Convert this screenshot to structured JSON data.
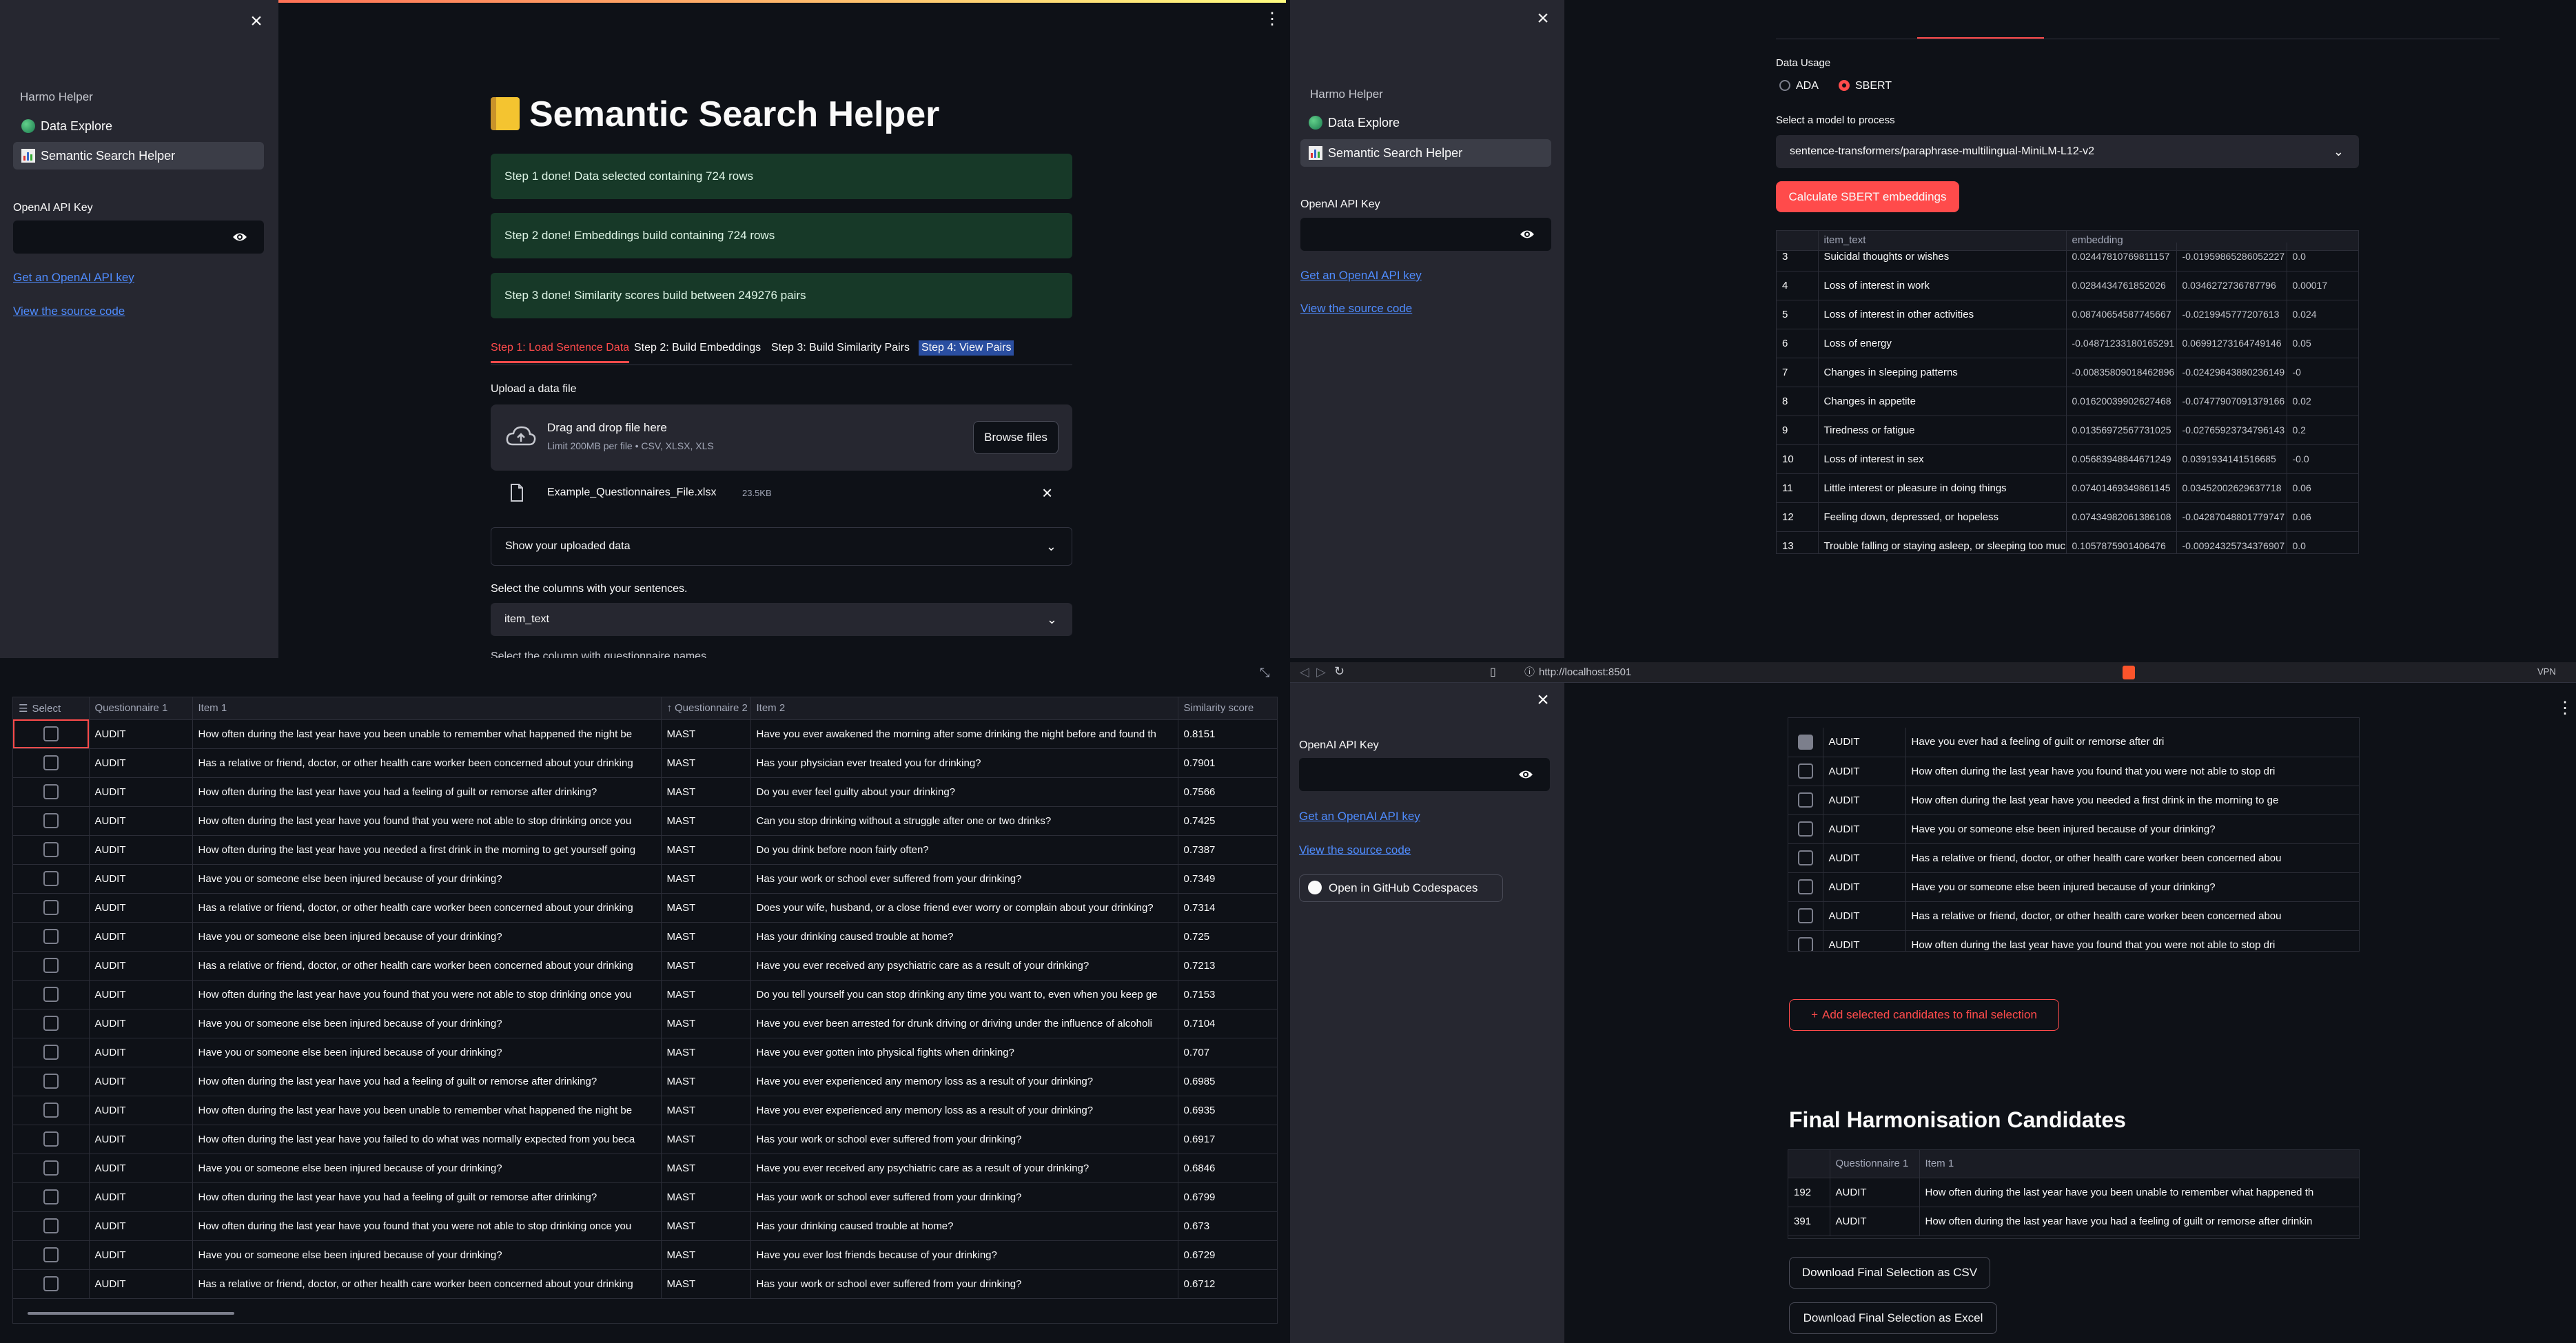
{
  "q1": {
    "sidebar": {
      "app_name": "Harmo Helper",
      "nav": [
        {
          "label": "Data Explore",
          "icon": "globe-icon"
        },
        {
          "label": "Semantic Search Helper",
          "icon": "bar-chart-icon"
        }
      ],
      "api_label": "OpenAI API Key",
      "link_key": "Get an OpenAI API key",
      "link_source": "View the source code"
    },
    "title": "Semantic Search Helper",
    "title_icon": "ledger-icon",
    "success": [
      "Step 1 done! Data selected containing 724 rows",
      "Step 2 done! Embeddings build containing 724 rows",
      "Step 3 done! Similarity scores build between 249276 pairs"
    ],
    "tabs": [
      "Step 1: Load Sentence Data",
      "Step 2: Build Embeddings",
      "Step 3: Build Similarity Pairs",
      "Step 4: View Pairs"
    ],
    "upload_label": "Upload a data file",
    "drop_text": "Drag and drop file here",
    "drop_limit": "Limit 200MB per file • CSV, XLSX, XLS",
    "browse": "Browse files",
    "file_name": "Example_Questionnaires_File.xlsx",
    "file_size": "23.5KB",
    "expander": "Show your uploaded data",
    "col_label": "Select the columns with your sentences.",
    "col_value": "item_text",
    "cut_text": "Select the column with questionnaire names"
  },
  "q2": {
    "sidebar": {
      "app_name": "Harmo Helper",
      "nav": [
        {
          "label": "Data Explore"
        },
        {
          "label": "Semantic Search Helper"
        }
      ],
      "api_label": "OpenAI API Key",
      "link_key": "Get an OpenAI API key",
      "link_source": "View the source code"
    },
    "usage_label": "Data Usage",
    "radio": [
      "ADA",
      "SBERT"
    ],
    "model_label": "Select a model to process",
    "model_value": "sentence-transformers/paraphrase-multilingual-MiniLM-L12-v2",
    "calc_button": "Calculate SBERT embeddings",
    "headers": [
      "",
      "item_text",
      "embedding"
    ],
    "rows": [
      [
        "3",
        "Suicidal thoughts or wishes",
        "0.02447810769811157",
        "-0.01959865286052227",
        "0.0"
      ],
      [
        "4",
        "Loss of interest in work",
        "0.0284434761852026",
        "0.0346272736787796",
        "0.00017"
      ],
      [
        "5",
        "Loss of interest in other activities",
        "0.08740654587745667",
        "-0.0219945777207613",
        "0.024"
      ],
      [
        "6",
        "Loss of energy",
        "-0.04871233180165291",
        "0.06991273164749146",
        "0.05"
      ],
      [
        "7",
        "Changes in sleeping patterns",
        "-0.00835809018462896",
        "-0.02429843880236149",
        "-0"
      ],
      [
        "8",
        "Changes in appetite",
        "0.01620039902627468",
        "-0.07477907091379166",
        "0.02"
      ],
      [
        "9",
        "Tiredness or fatigue",
        "0.01356972567731025",
        "-0.02765923734796143",
        "0.2"
      ],
      [
        "10",
        "Loss of interest in sex",
        "0.05683948844671249",
        "0.0391934141516685",
        "-0.0"
      ],
      [
        "11",
        "Little interest or pleasure in doing things",
        "0.07401469349861145",
        "0.03452002629637718",
        "0.06"
      ],
      [
        "12",
        "Feeling down, depressed, or hopeless",
        "0.07434982061386108",
        "-0.04287048801779747",
        "0.06"
      ],
      [
        "13",
        "Trouble falling or staying asleep, or sleeping too much",
        "0.1057875901406476",
        "-0.00924325734376907",
        "0.0"
      ]
    ]
  },
  "q3": {
    "headers": [
      "Select",
      "Questionnaire 1",
      "Item 1",
      "Questionnaire 2",
      "Item 2",
      "Similarity score"
    ],
    "rows": [
      [
        "AUDIT",
        "How often during the last year have you been unable to remember what happened the night be",
        "MAST",
        "Have you ever awakened the morning after some drinking the night before and found th",
        "0.8151"
      ],
      [
        "AUDIT",
        "Has a relative or friend, doctor, or other health care worker been concerned about your drinking",
        "MAST",
        "Has your physician ever treated you for drinking?",
        "0.7901"
      ],
      [
        "AUDIT",
        "How often during the last year have you had a feeling of guilt or remorse after drinking?",
        "MAST",
        "Do you ever feel guilty about your drinking?",
        "0.7566"
      ],
      [
        "AUDIT",
        "How often during the last year have you found that you were not able to stop drinking once you",
        "MAST",
        "Can you stop drinking without a struggle after one or two drinks?",
        "0.7425"
      ],
      [
        "AUDIT",
        "How often during the last year have you needed a first drink in the morning to get yourself going",
        "MAST",
        "Do you drink before noon fairly often?",
        "0.7387"
      ],
      [
        "AUDIT",
        "Have you or someone else been injured because of your drinking?",
        "MAST",
        "Has your work or school ever suffered from your drinking?",
        "0.7349"
      ],
      [
        "AUDIT",
        "Has a relative or friend, doctor, or other health care worker been concerned about your drinking",
        "MAST",
        "Does your wife, husband, or a close friend ever worry or complain about your drinking?",
        "0.7314"
      ],
      [
        "AUDIT",
        "Have you or someone else been injured because of your drinking?",
        "MAST",
        "Has your drinking caused trouble at home?",
        "0.725"
      ],
      [
        "AUDIT",
        "Has a relative or friend, doctor, or other health care worker been concerned about your drinking",
        "MAST",
        "Have you ever received any psychiatric care as a result of your drinking?",
        "0.7213"
      ],
      [
        "AUDIT",
        "How often during the last year have you found that you were not able to stop drinking once you",
        "MAST",
        "Do you tell yourself you can stop drinking any time you want to, even when you keep ge",
        "0.7153"
      ],
      [
        "AUDIT",
        "Have you or someone else been injured because of your drinking?",
        "MAST",
        "Have you ever been arrested for drunk driving or driving under the influence of alcoholi",
        "0.7104"
      ],
      [
        "AUDIT",
        "Have you or someone else been injured because of your drinking?",
        "MAST",
        "Have you ever gotten into physical fights when drinking?",
        "0.707"
      ],
      [
        "AUDIT",
        "How often during the last year have you had a feeling of guilt or remorse after drinking?",
        "MAST",
        "Have you ever experienced any memory loss as a result of your drinking?",
        "0.6985"
      ],
      [
        "AUDIT",
        "How often during the last year have you been unable to remember what happened the night be",
        "MAST",
        "Have you ever experienced any memory loss as a result of your drinking?",
        "0.6935"
      ],
      [
        "AUDIT",
        "How often during the last year have you failed to do what was normally expected from you beca",
        "MAST",
        "Has your work or school ever suffered from your drinking?",
        "0.6917"
      ],
      [
        "AUDIT",
        "Have you or someone else been injured because of your drinking?",
        "MAST",
        "Have you ever received any psychiatric care as a result of your drinking?",
        "0.6846"
      ],
      [
        "AUDIT",
        "How often during the last year have you had a feeling of guilt or remorse after drinking?",
        "MAST",
        "Has your work or school ever suffered from your drinking?",
        "0.6799"
      ],
      [
        "AUDIT",
        "How often during the last year have you found that you were not able to stop drinking once you",
        "MAST",
        "Has your drinking caused trouble at home?",
        "0.673"
      ],
      [
        "AUDIT",
        "Have you or someone else been injured because of your drinking?",
        "MAST",
        "Have you ever lost friends because of your drinking?",
        "0.6729"
      ],
      [
        "AUDIT",
        "Has a relative or friend, doctor, or other health care worker been concerned about your drinking",
        "MAST",
        "Has your work or school ever suffered from your drinking?",
        "0.6712"
      ]
    ]
  },
  "q4": {
    "url": "http://localhost:8501",
    "vpn": "VPN",
    "sidebar": {
      "api_label": "OpenAI API Key",
      "link_key": "Get an OpenAI API key",
      "link_source": "View the source code",
      "codespaces": "Open in GitHub Codespaces"
    },
    "rows": [
      [
        "AUDIT",
        "Have you ever had a feeling of guilt or remorse after dri",
        true
      ],
      [
        "AUDIT",
        "How often during the last year have you found that you were not able to stop dri",
        false
      ],
      [
        "AUDIT",
        "How often during the last year have you needed a first drink in the morning to ge",
        false
      ],
      [
        "AUDIT",
        "Have you or someone else been injured because of your drinking?",
        false
      ],
      [
        "AUDIT",
        "Has a relative or friend, doctor, or other health care worker been concerned abou",
        false
      ],
      [
        "AUDIT",
        "Have you or someone else been injured because of your drinking?",
        false
      ],
      [
        "AUDIT",
        "Has a relative or friend, doctor, or other health care worker been concerned abou",
        false
      ],
      [
        "AUDIT",
        "How often during the last year have you found that you were not able to stop dri",
        false
      ]
    ],
    "add_button": "Add selected candidates to final selection",
    "final_title": "Final Harmonisation Candidates",
    "final_headers": [
      "",
      "Questionnaire 1",
      "Item 1"
    ],
    "final_rows": [
      [
        "192",
        "AUDIT",
        "How often during the last year have you been unable to remember what happened th"
      ],
      [
        "391",
        "AUDIT",
        "How often during the last year have you had a feeling of guilt or remorse after drinkin"
      ]
    ],
    "dl_csv": "Download Final Selection as CSV",
    "dl_xlsx": "Download Final Selection as Excel"
  }
}
